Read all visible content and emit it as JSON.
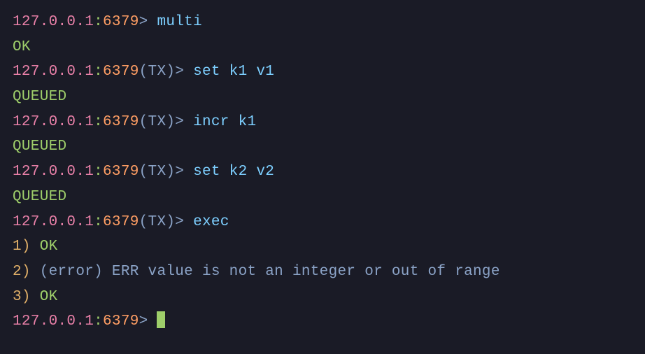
{
  "prompt": {
    "host": "127.0.0.1",
    "colon": ":",
    "port": "6379",
    "tx": "(TX)",
    "gt": ">"
  },
  "lines": {
    "cmd1": "multi",
    "resp1": "OK",
    "cmd2": "set k1 v1",
    "resp2": "QUEUED",
    "cmd3": "incr k1",
    "resp3": "QUEUED",
    "cmd4": "set k2 v2",
    "resp4": "QUEUED",
    "cmd5": "exec",
    "result1_num": "1)",
    "result1_val": "OK",
    "result2_num": "2)",
    "result2_val": "(error) ERR value is not an integer or out of range",
    "result3_num": "3)",
    "result3_val": "OK"
  }
}
